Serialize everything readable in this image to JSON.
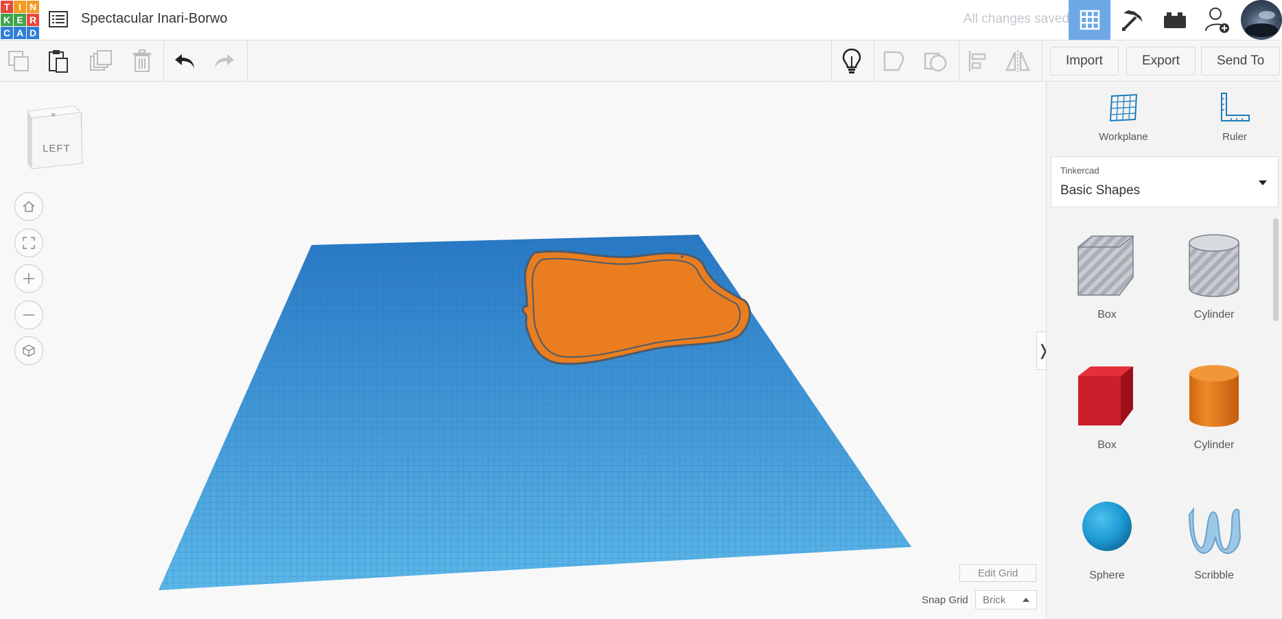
{
  "logo": {
    "letters": [
      "T",
      "I",
      "N",
      "K",
      "E",
      "R",
      "C",
      "A",
      "D"
    ],
    "colors": [
      "#e8473c",
      "#f39a21",
      "#f39a21",
      "#3fa34d",
      "#3fa34d",
      "#e8473c",
      "#2f7ed8",
      "#2f7ed8",
      "#2f7ed8"
    ]
  },
  "header": {
    "design_title": "Spectacular Inari-Borwo",
    "save_status": "All changes saved"
  },
  "toolbar": {
    "import_label": "Import",
    "export_label": "Export",
    "send_to_label": "Send To"
  },
  "viewport": {
    "view_cube_label": "LEFT",
    "edit_grid_label": "Edit Grid",
    "snap_grid_label": "Snap Grid",
    "snap_grid_value": "Brick"
  },
  "panel": {
    "tools": [
      {
        "label": "Workplane",
        "icon": "workplane-icon"
      },
      {
        "label": "Ruler",
        "icon": "ruler-icon"
      }
    ],
    "library_source": "Tinkercad",
    "library_name": "Basic Shapes",
    "shapes": [
      {
        "label": "Box",
        "kind": "box-hole"
      },
      {
        "label": "Cylinder",
        "kind": "cylinder-hole"
      },
      {
        "label": "Box",
        "kind": "box"
      },
      {
        "label": "Cylinder",
        "kind": "cylinder"
      },
      {
        "label": "Sphere",
        "kind": "sphere"
      },
      {
        "label": "Scribble",
        "kind": "scribble"
      }
    ]
  },
  "colors": {
    "accent": "#6ea7e6",
    "workplane": "#3a9ad9",
    "shape_orange": "#e97d1f",
    "box_red": "#cc1f2b",
    "sphere_blue": "#1f9bd4"
  }
}
